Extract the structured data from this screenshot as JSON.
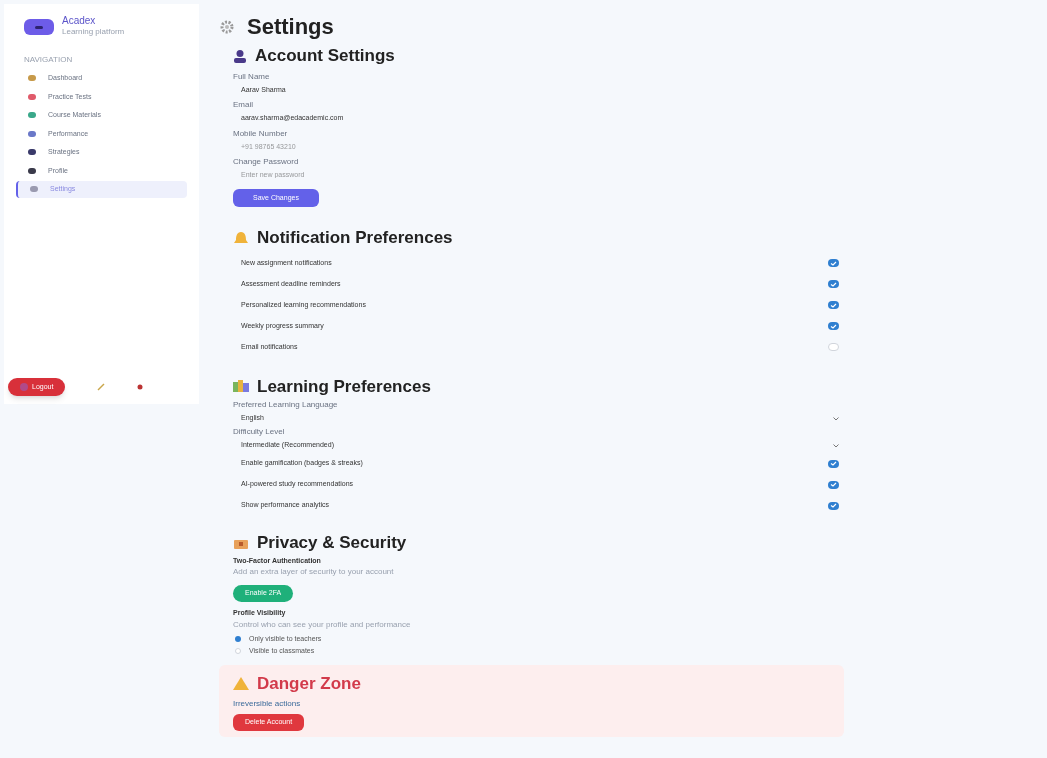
{
  "sidebar": {
    "brand": "Acadex",
    "brand_subtitle": "Learning platform",
    "section_label": "NAVIGATION",
    "items": [
      {
        "label": "Dashboard",
        "selected": false
      },
      {
        "label": "Practice Tests",
        "selected": false
      },
      {
        "label": "Course Materials",
        "selected": false
      },
      {
        "label": "Performance",
        "selected": false
      },
      {
        "label": "Strategies",
        "selected": false
      },
      {
        "label": "Profile",
        "selected": false
      },
      {
        "label": "Settings",
        "selected": true
      }
    ],
    "logout": "Logout"
  },
  "page_title": "Settings",
  "account": {
    "title": "Account Settings",
    "fields": [
      {
        "label": "Full Name",
        "value": "Aarav Sharma"
      },
      {
        "label": "Email",
        "value": "aarav.sharma@edacademic.com"
      },
      {
        "label": "Mobile Number",
        "placeholder": "+91 98765 43210"
      },
      {
        "label": "Change Password",
        "placeholder": "Enter new password"
      }
    ],
    "save": "Save Changes"
  },
  "notifications": {
    "title": "Notification Preferences",
    "options": [
      {
        "label": "New assignment notifications",
        "checked": true
      },
      {
        "label": "Assessment deadline reminders",
        "checked": true
      },
      {
        "label": "Personalized learning recommendations",
        "checked": true
      },
      {
        "label": "Weekly progress summary",
        "checked": true
      },
      {
        "label": "Email notifications",
        "checked": false
      }
    ]
  },
  "learning": {
    "title": "Learning Preferences",
    "selects": [
      {
        "label": "Preferred Learning Language",
        "value": "English"
      },
      {
        "label": "Difficulty Level",
        "value": "Intermediate (Recommended)"
      }
    ],
    "options": [
      {
        "label": "Enable gamification (badges & streaks)",
        "checked": true
      },
      {
        "label": "AI-powered study recommendations",
        "checked": true
      },
      {
        "label": "Show performance analytics",
        "checked": true
      }
    ]
  },
  "privacy": {
    "title": "Privacy & Security",
    "twofa_title": "Two-Factor Authentication",
    "twofa_text": "Add an extra layer of security to your account",
    "twofa_button": "Enable 2FA",
    "visibility_title": "Profile Visibility",
    "visibility_text": "Control who can see your profile and performance",
    "visibility_options": [
      {
        "label": "Only visible to teachers",
        "selected": true
      },
      {
        "label": "Visible to classmates",
        "selected": false
      }
    ]
  },
  "danger": {
    "title": "Danger Zone",
    "text": "Irreversible actions",
    "button": "Delete Account"
  }
}
